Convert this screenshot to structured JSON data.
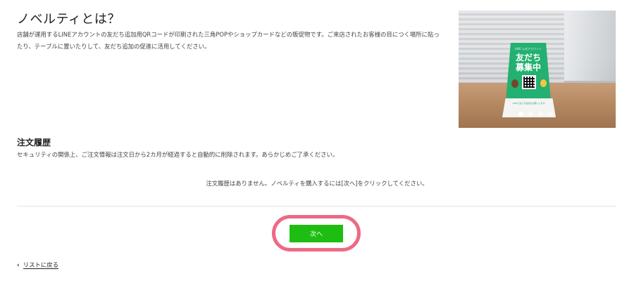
{
  "header": {
    "title": "ノベルティとは？",
    "description_line1": "店舗が運用するLINEアカウントの友だち追加用QRコードが印刷された三角POPやショップカードなどの販促物です。ご来店されたお客様の目につく場所に貼っ",
    "description_line2": "たり、テーブルに置いたりして、友だち追加の促進に活用してください。"
  },
  "carousel": {
    "pop_header": "LINE 公式アカウント",
    "pop_headline_line1": "友だち",
    "pop_headline_line2": "募集中",
    "pop_small_print": "LINEで友だち追加をお願いします!",
    "slide_count": 4,
    "active_slide": 1
  },
  "order_history": {
    "heading": "注文履歴",
    "security_note": "セキュリティの関係上、ご注文情報は注文日から2カ月が経過すると自動的に削除されます。あらかじめご了承ください。",
    "empty_message": "注文履歴はありません。ノベルティを購入するには[次へ]をクリックしてください。"
  },
  "actions": {
    "next_label": "次へ",
    "back_label": "リストに戻る",
    "back_icon": "chevron-left-icon"
  },
  "colors": {
    "accent_green": "#1ebd12",
    "highlight_pink": "#ec6a86",
    "pop_green": "#23b070"
  }
}
